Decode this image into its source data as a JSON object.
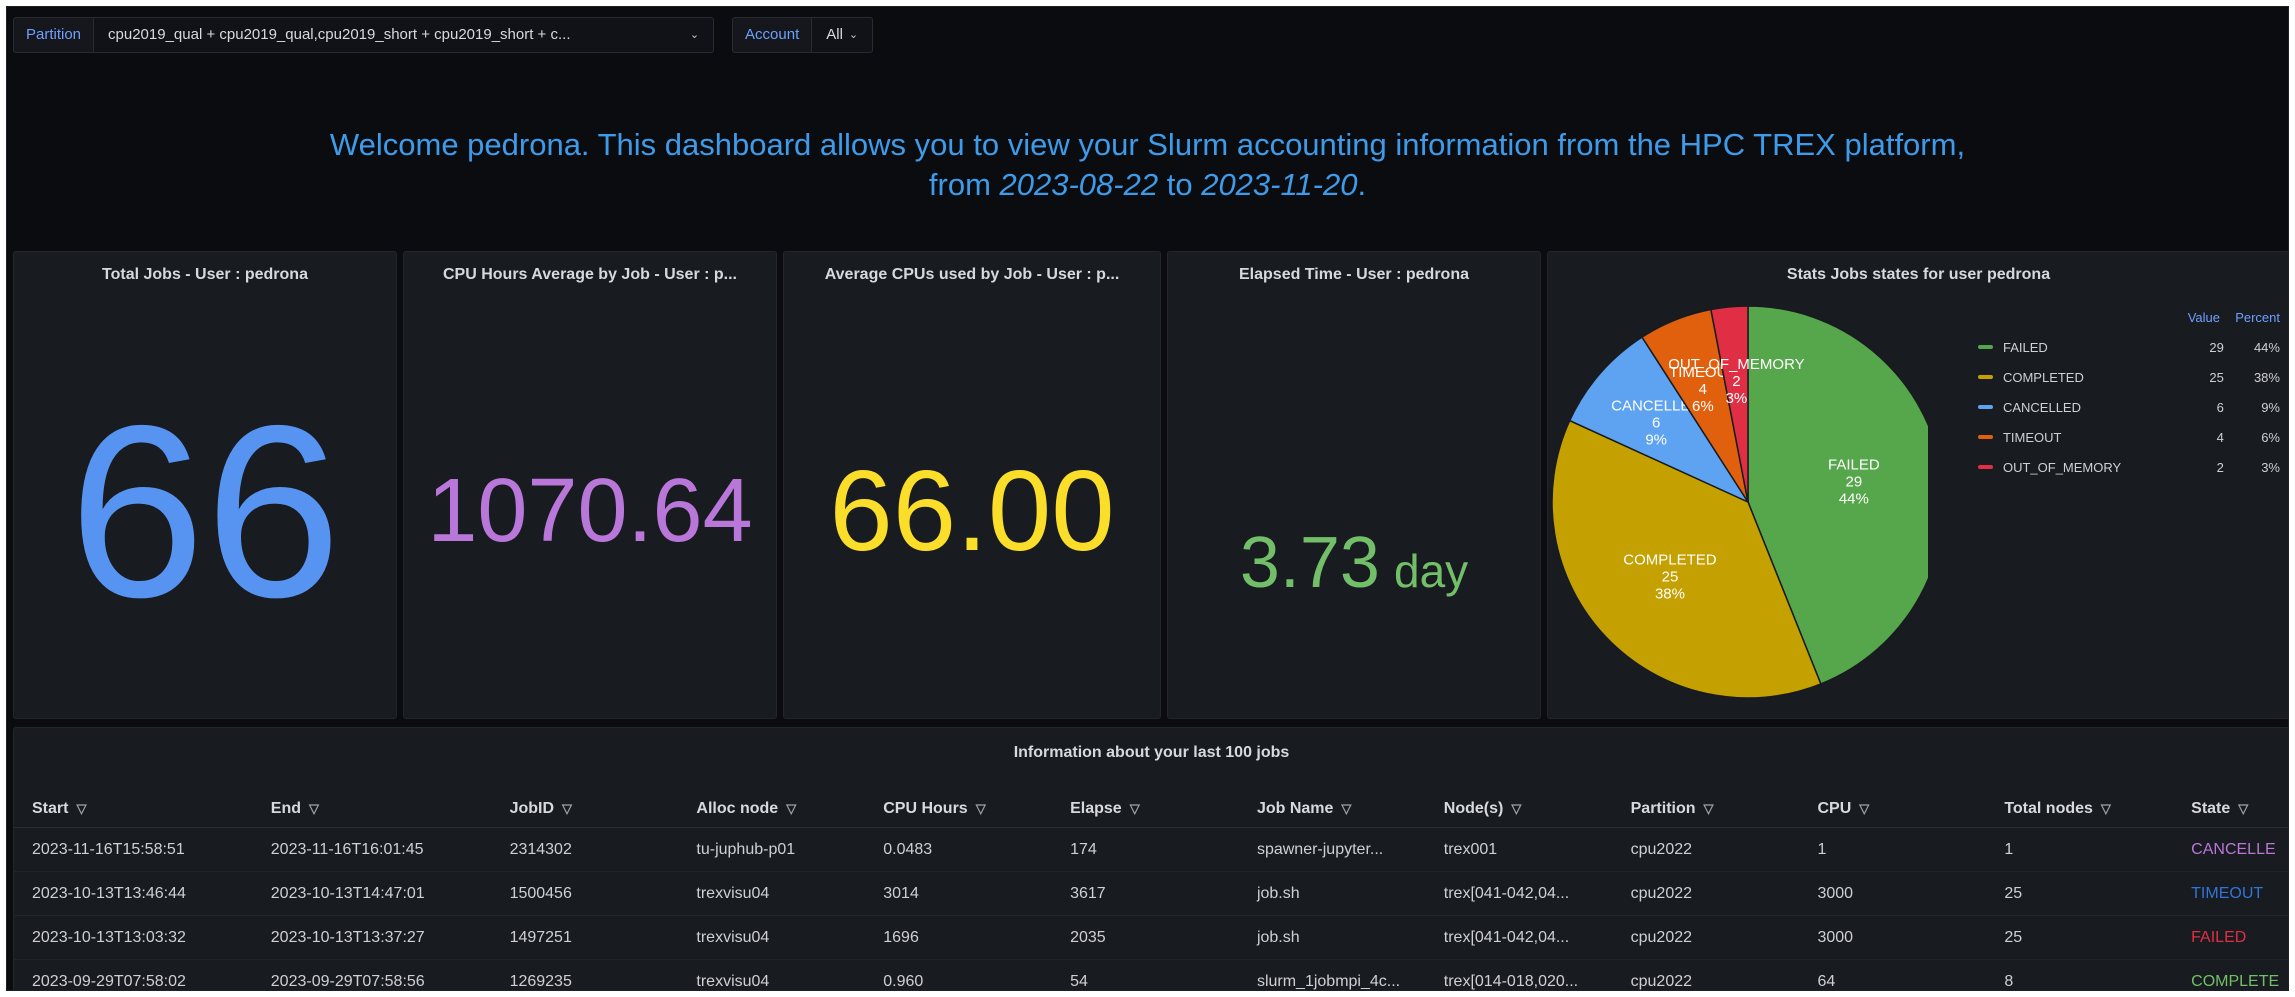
{
  "variables": {
    "partition_label": "Partition",
    "partition_value": "cpu2019_qual + cpu2019_qual,cpu2019_short + cpu2019_short + c...",
    "account_label": "Account",
    "account_value": "All"
  },
  "welcome": {
    "line1": "Welcome pedrona. This dashboard allows you to view your Slurm accounting information from the HPC TREX platform,",
    "from_word": "from",
    "start_date": "2023-08-22",
    "to_word": "to",
    "end_date": "2023-11-20",
    "end_punct": "."
  },
  "stats": {
    "total_jobs": {
      "title": "Total Jobs - User : pedrona",
      "value": "66",
      "color": "#5794f2"
    },
    "cpu_hours": {
      "title": "CPU Hours Average by Job - User : p...",
      "value": "1070.64",
      "color": "#b877d9"
    },
    "avg_cpus": {
      "title": "Average CPUs used by Job - User : p...",
      "value": "66.00",
      "color": "#fade2a"
    },
    "elapsed": {
      "title": "Elapsed Time - User : pedrona",
      "value": "3.73",
      "unit": "day",
      "color": "#73bf69"
    }
  },
  "pie": {
    "title": "Stats Jobs states for user pedrona",
    "legend_value_header": "Value",
    "legend_percent_header": "Percent",
    "chart_data": {
      "type": "pie",
      "title": "Stats Jobs states for user pedrona",
      "legend_position": "right",
      "slices": [
        {
          "name": "FAILED",
          "value": 29,
          "percent": "44%",
          "color": "#56a64b"
        },
        {
          "name": "COMPLETED",
          "value": 25,
          "percent": "38%",
          "color": "#c4a000"
        },
        {
          "name": "CANCELLED",
          "value": 6,
          "percent": "9%",
          "color": "#5ea2f2"
        },
        {
          "name": "TIMEOUT",
          "value": 4,
          "percent": "6%",
          "color": "#e0600e"
        },
        {
          "name": "OUT_OF_MEMORY",
          "value": 2,
          "percent": "3%",
          "color": "#e02f44"
        }
      ]
    }
  },
  "table": {
    "title": "Information about your last 100 jobs",
    "columns": [
      "Start",
      "End",
      "JobID",
      "Alloc node",
      "CPU Hours",
      "Elapse",
      "Job Name",
      "Node(s)",
      "Partition",
      "CPU",
      "Total nodes",
      "State"
    ],
    "rows": [
      {
        "cells": [
          "2023-11-16T15:58:51",
          "2023-11-16T16:01:45",
          "2314302",
          "tu-juphub-p01",
          "0.0483",
          "174",
          "spawner-jupyter...",
          "trex001",
          "cpu2022",
          "1",
          "1",
          "CANCELLE"
        ],
        "state_color": "#b877d9"
      },
      {
        "cells": [
          "2023-10-13T13:46:44",
          "2023-10-13T14:47:01",
          "1500456",
          "trexvisu04",
          "3014",
          "3617",
          "job.sh",
          "trex[041-042,04...",
          "cpu2022",
          "3000",
          "25",
          "TIMEOUT"
        ],
        "state_color": "#3274d9"
      },
      {
        "cells": [
          "2023-10-13T13:03:32",
          "2023-10-13T13:37:27",
          "1497251",
          "trexvisu04",
          "1696",
          "2035",
          "job.sh",
          "trex[041-042,04...",
          "cpu2022",
          "3000",
          "25",
          "FAILED"
        ],
        "state_color": "#e02f44"
      },
      {
        "cells": [
          "2023-09-29T07:58:02",
          "2023-09-29T07:58:56",
          "1269235",
          "trexvisu04",
          "0.960",
          "54",
          "slurm_1jobmpi_4c...",
          "trex[014-018,020...",
          "cpu2022",
          "64",
          "8",
          "COMPLETE"
        ],
        "state_color": "#73bf69"
      }
    ]
  }
}
